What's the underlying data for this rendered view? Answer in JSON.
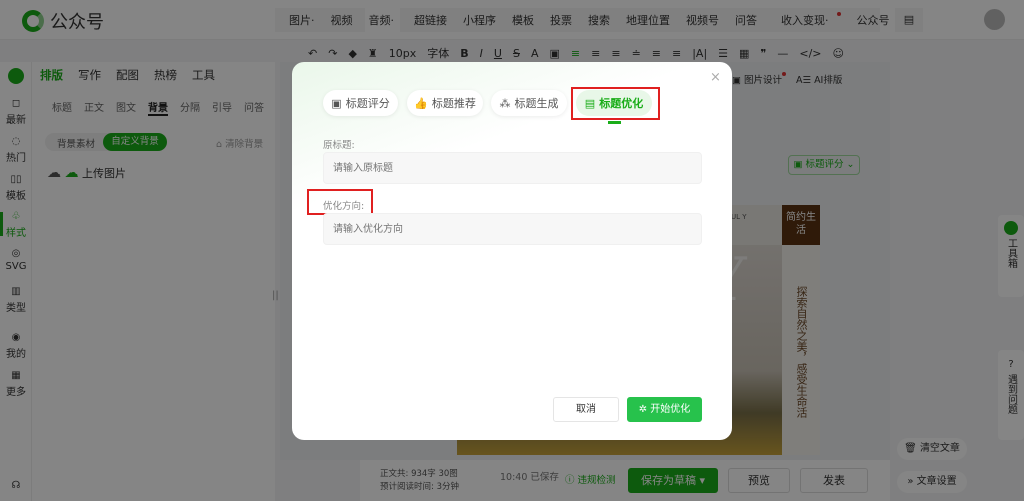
{
  "header": {
    "brand": "公众号",
    "nav_group1": [
      "图片·",
      "视频",
      "音频·"
    ],
    "nav_group2": [
      "超链接",
      "小程序",
      "模板",
      "投票",
      "搜索",
      "地理位置",
      "视频号",
      "问答",
      "收入变现·",
      "公众号",
      "···"
    ]
  },
  "toolbar": {
    "font_size": "10px",
    "font": "字体"
  },
  "side_tabs": [
    "排版",
    "写作",
    "配图",
    "热榜",
    "工具"
  ],
  "sub_tabs": [
    "标题",
    "正文",
    "图文",
    "背景",
    "分隔",
    "引导",
    "问答"
  ],
  "sidebar": [
    {
      "label": "最新"
    },
    {
      "label": "热门"
    },
    {
      "label": "模板"
    },
    {
      "label": "样式"
    },
    {
      "label": "SVG"
    },
    {
      "label": "类型"
    },
    {
      "label": "我的"
    },
    {
      "label": "更多"
    }
  ],
  "panel": {
    "pill_material": "背景素材",
    "pill_custom": "自定义背景",
    "clear_bg": "清除背景",
    "upload": "上传图片"
  },
  "editor": {
    "image_design": "图片设计",
    "ai_layout": "AI排版",
    "title_score": "标题评分",
    "brand_tag": "简约生活",
    "article_vertical": "探索自然之美，感受生命活",
    "article_en": "FUL Y",
    "big_letter": "Y"
  },
  "right": {
    "toolbox": "工具箱",
    "help": "遇到问题",
    "clear_article": "清空文章",
    "article_settings": "文章设置"
  },
  "bottom": {
    "word_count": "正文共: 934字 30图",
    "read_time": "预计阅读时间: 3分钟",
    "saved_time": "10:40",
    "saved": "已保存",
    "check": "违规检测",
    "save_draft": "保存为草稿",
    "preview": "预览",
    "publish": "发表"
  },
  "modal": {
    "tabs": [
      "标题评分",
      "标题推荐",
      "标题生成",
      "标题优化"
    ],
    "active_tab": "标题优化",
    "original_label": "原标题:",
    "original_placeholder": "请输入原标题",
    "direction_label": "优化方向:",
    "direction_placeholder": "请输入优化方向",
    "cancel": "取消",
    "start": "开始优化"
  },
  "colors": {
    "accent": "#1aad19",
    "highlight": "#e02020"
  }
}
